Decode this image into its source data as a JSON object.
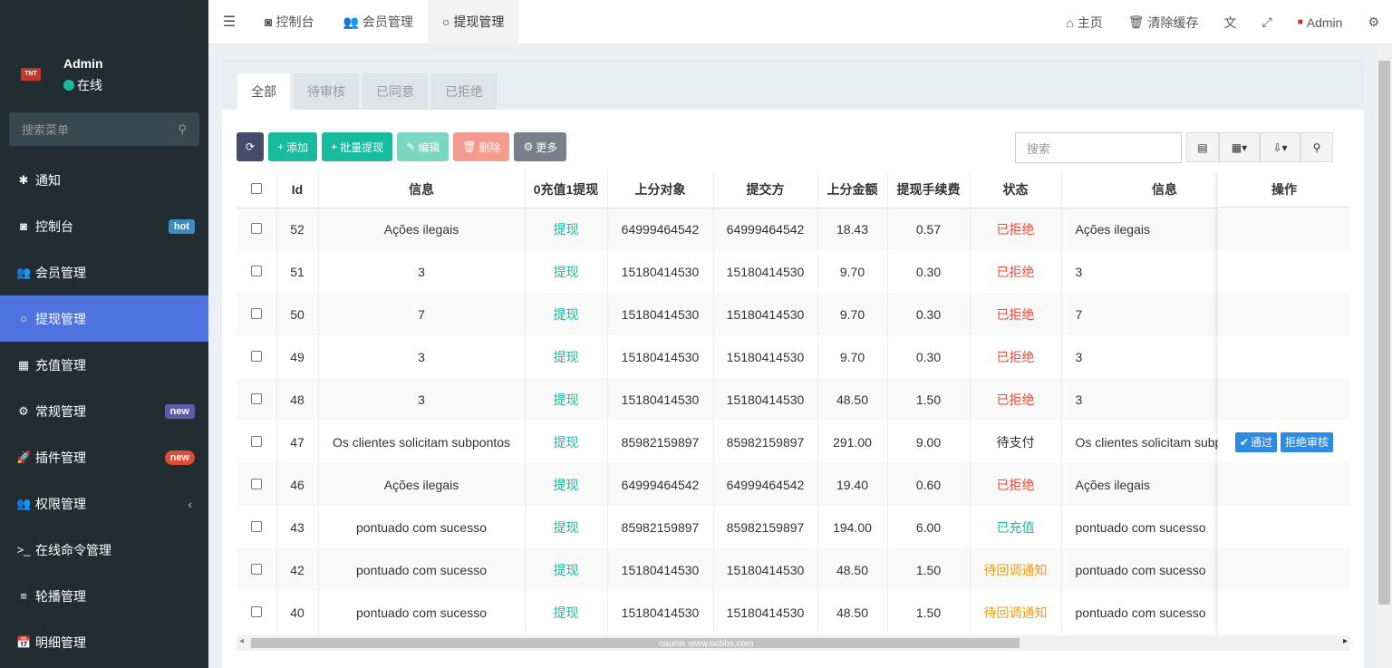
{
  "sidebar": {
    "user_name": "Admin",
    "user_status": "在线",
    "logo_text": "TNT",
    "search_placeholder": "搜索菜单",
    "items": [
      {
        "icon": "✱",
        "label": "通知"
      },
      {
        "icon": "◙",
        "label": "控制台",
        "badge": "hot"
      },
      {
        "icon": "👥",
        "label": "会员管理"
      },
      {
        "icon": "○",
        "label": "提现管理"
      },
      {
        "icon": "▦",
        "label": "充值管理"
      },
      {
        "icon": "⚙",
        "label": "常规管理",
        "badge": "new"
      },
      {
        "icon": "🚀",
        "label": "插件管理",
        "badge": "new"
      },
      {
        "icon": "👥",
        "label": "权限管理"
      },
      {
        "icon": ">_",
        "label": "在线命令管理"
      },
      {
        "icon": "≡",
        "label": "轮播管理"
      },
      {
        "icon": "📅",
        "label": "明细管理"
      }
    ]
  },
  "topbar": {
    "tabs": [
      "控制台",
      "会员管理",
      "提现管理"
    ],
    "home": "主页",
    "clear_cache": "清除缓存",
    "admin": "Admin"
  },
  "filter_tabs": [
    "全部",
    "待审核",
    "已同意",
    "已拒绝"
  ],
  "toolbar": {
    "add": "添加",
    "batch": "批量提现",
    "edit": "编辑",
    "delete": "删除",
    "more": "更多",
    "search_placeholder": "搜索"
  },
  "table": {
    "headers": [
      "Id",
      "信息",
      "0充值1提现",
      "上分对象",
      "提交方",
      "上分金额",
      "提现手续费",
      "状态",
      "信息",
      "操作"
    ],
    "rows": [
      {
        "id": "52",
        "info": "Ações ilegais",
        "type": "提现",
        "target": "64999464542",
        "submitter": "64999464542",
        "amount": "18.43",
        "fee": "0.57",
        "status": "已拒绝",
        "status_color": "red",
        "info2": "Ações ilegais"
      },
      {
        "id": "51",
        "info": "3",
        "type": "提现",
        "target": "15180414530",
        "submitter": "15180414530",
        "amount": "9.70",
        "fee": "0.30",
        "status": "已拒绝",
        "status_color": "red",
        "info2": "3"
      },
      {
        "id": "50",
        "info": "7",
        "type": "提现",
        "target": "15180414530",
        "submitter": "15180414530",
        "amount": "9.70",
        "fee": "0.30",
        "status": "已拒绝",
        "status_color": "red",
        "info2": "7"
      },
      {
        "id": "49",
        "info": "3",
        "type": "提现",
        "target": "15180414530",
        "submitter": "15180414530",
        "amount": "9.70",
        "fee": "0.30",
        "status": "已拒绝",
        "status_color": "red",
        "info2": "3"
      },
      {
        "id": "48",
        "info": "3",
        "type": "提现",
        "target": "15180414530",
        "submitter": "15180414530",
        "amount": "48.50",
        "fee": "1.50",
        "status": "已拒绝",
        "status_color": "red",
        "info2": "3"
      },
      {
        "id": "47",
        "info": "Os clientes solicitam subpontos",
        "type": "提现",
        "target": "85982159897",
        "submitter": "85982159897",
        "amount": "291.00",
        "fee": "9.00",
        "status": "待支付",
        "status_color": "default",
        "info2": "Os clientes solicitam subpontos"
      },
      {
        "id": "46",
        "info": "Ações ilegais",
        "type": "提现",
        "target": "64999464542",
        "submitter": "64999464542",
        "amount": "19.40",
        "fee": "0.60",
        "status": "已拒绝",
        "status_color": "red",
        "info2": "Ações ilegais"
      },
      {
        "id": "43",
        "info": "pontuado com sucesso",
        "type": "提现",
        "target": "85982159897",
        "submitter": "85982159897",
        "amount": "194.00",
        "fee": "6.00",
        "status": "已充值",
        "status_color": "green",
        "info2": "pontuado com sucesso"
      },
      {
        "id": "42",
        "info": "pontuado com sucesso",
        "type": "提现",
        "target": "15180414530",
        "submitter": "15180414530",
        "amount": "48.50",
        "fee": "1.50",
        "status": "待回调通知",
        "status_color": "orange",
        "info2": "pontuado com sucesso"
      },
      {
        "id": "40",
        "info": "pontuado com sucesso",
        "type": "提现",
        "target": "15180414530",
        "submitter": "15180414530",
        "amount": "48.50",
        "fee": "1.50",
        "status": "待回调通知",
        "status_color": "orange",
        "info2": "pontuado com sucesso"
      }
    ],
    "row_actions": {
      "approve": "通过",
      "reject": "拒绝审核"
    },
    "watermark": "oaunis www.ocbbs.com"
  }
}
